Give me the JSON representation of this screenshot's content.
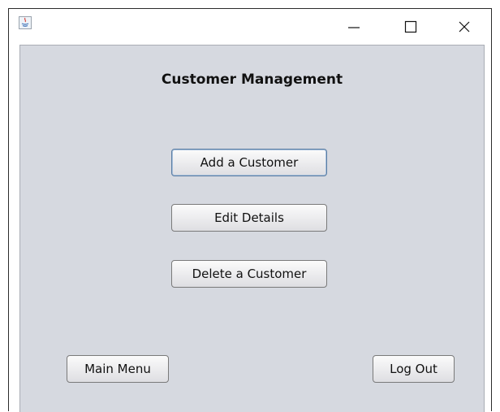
{
  "window": {
    "title_icon": "java-icon",
    "controls": {
      "minimize": "minimize-icon",
      "maximize": "maximize-icon",
      "close": "close-icon"
    }
  },
  "page": {
    "title": "Customer Management"
  },
  "buttons": {
    "add_customer": "Add a Customer",
    "edit_details": "Edit Details",
    "delete_customer": "Delete a Customer",
    "main_menu": "Main Menu",
    "log_out": "Log Out"
  },
  "colors": {
    "panel_bg": "#d6d9e0",
    "focus_border": "#5a7da3"
  }
}
